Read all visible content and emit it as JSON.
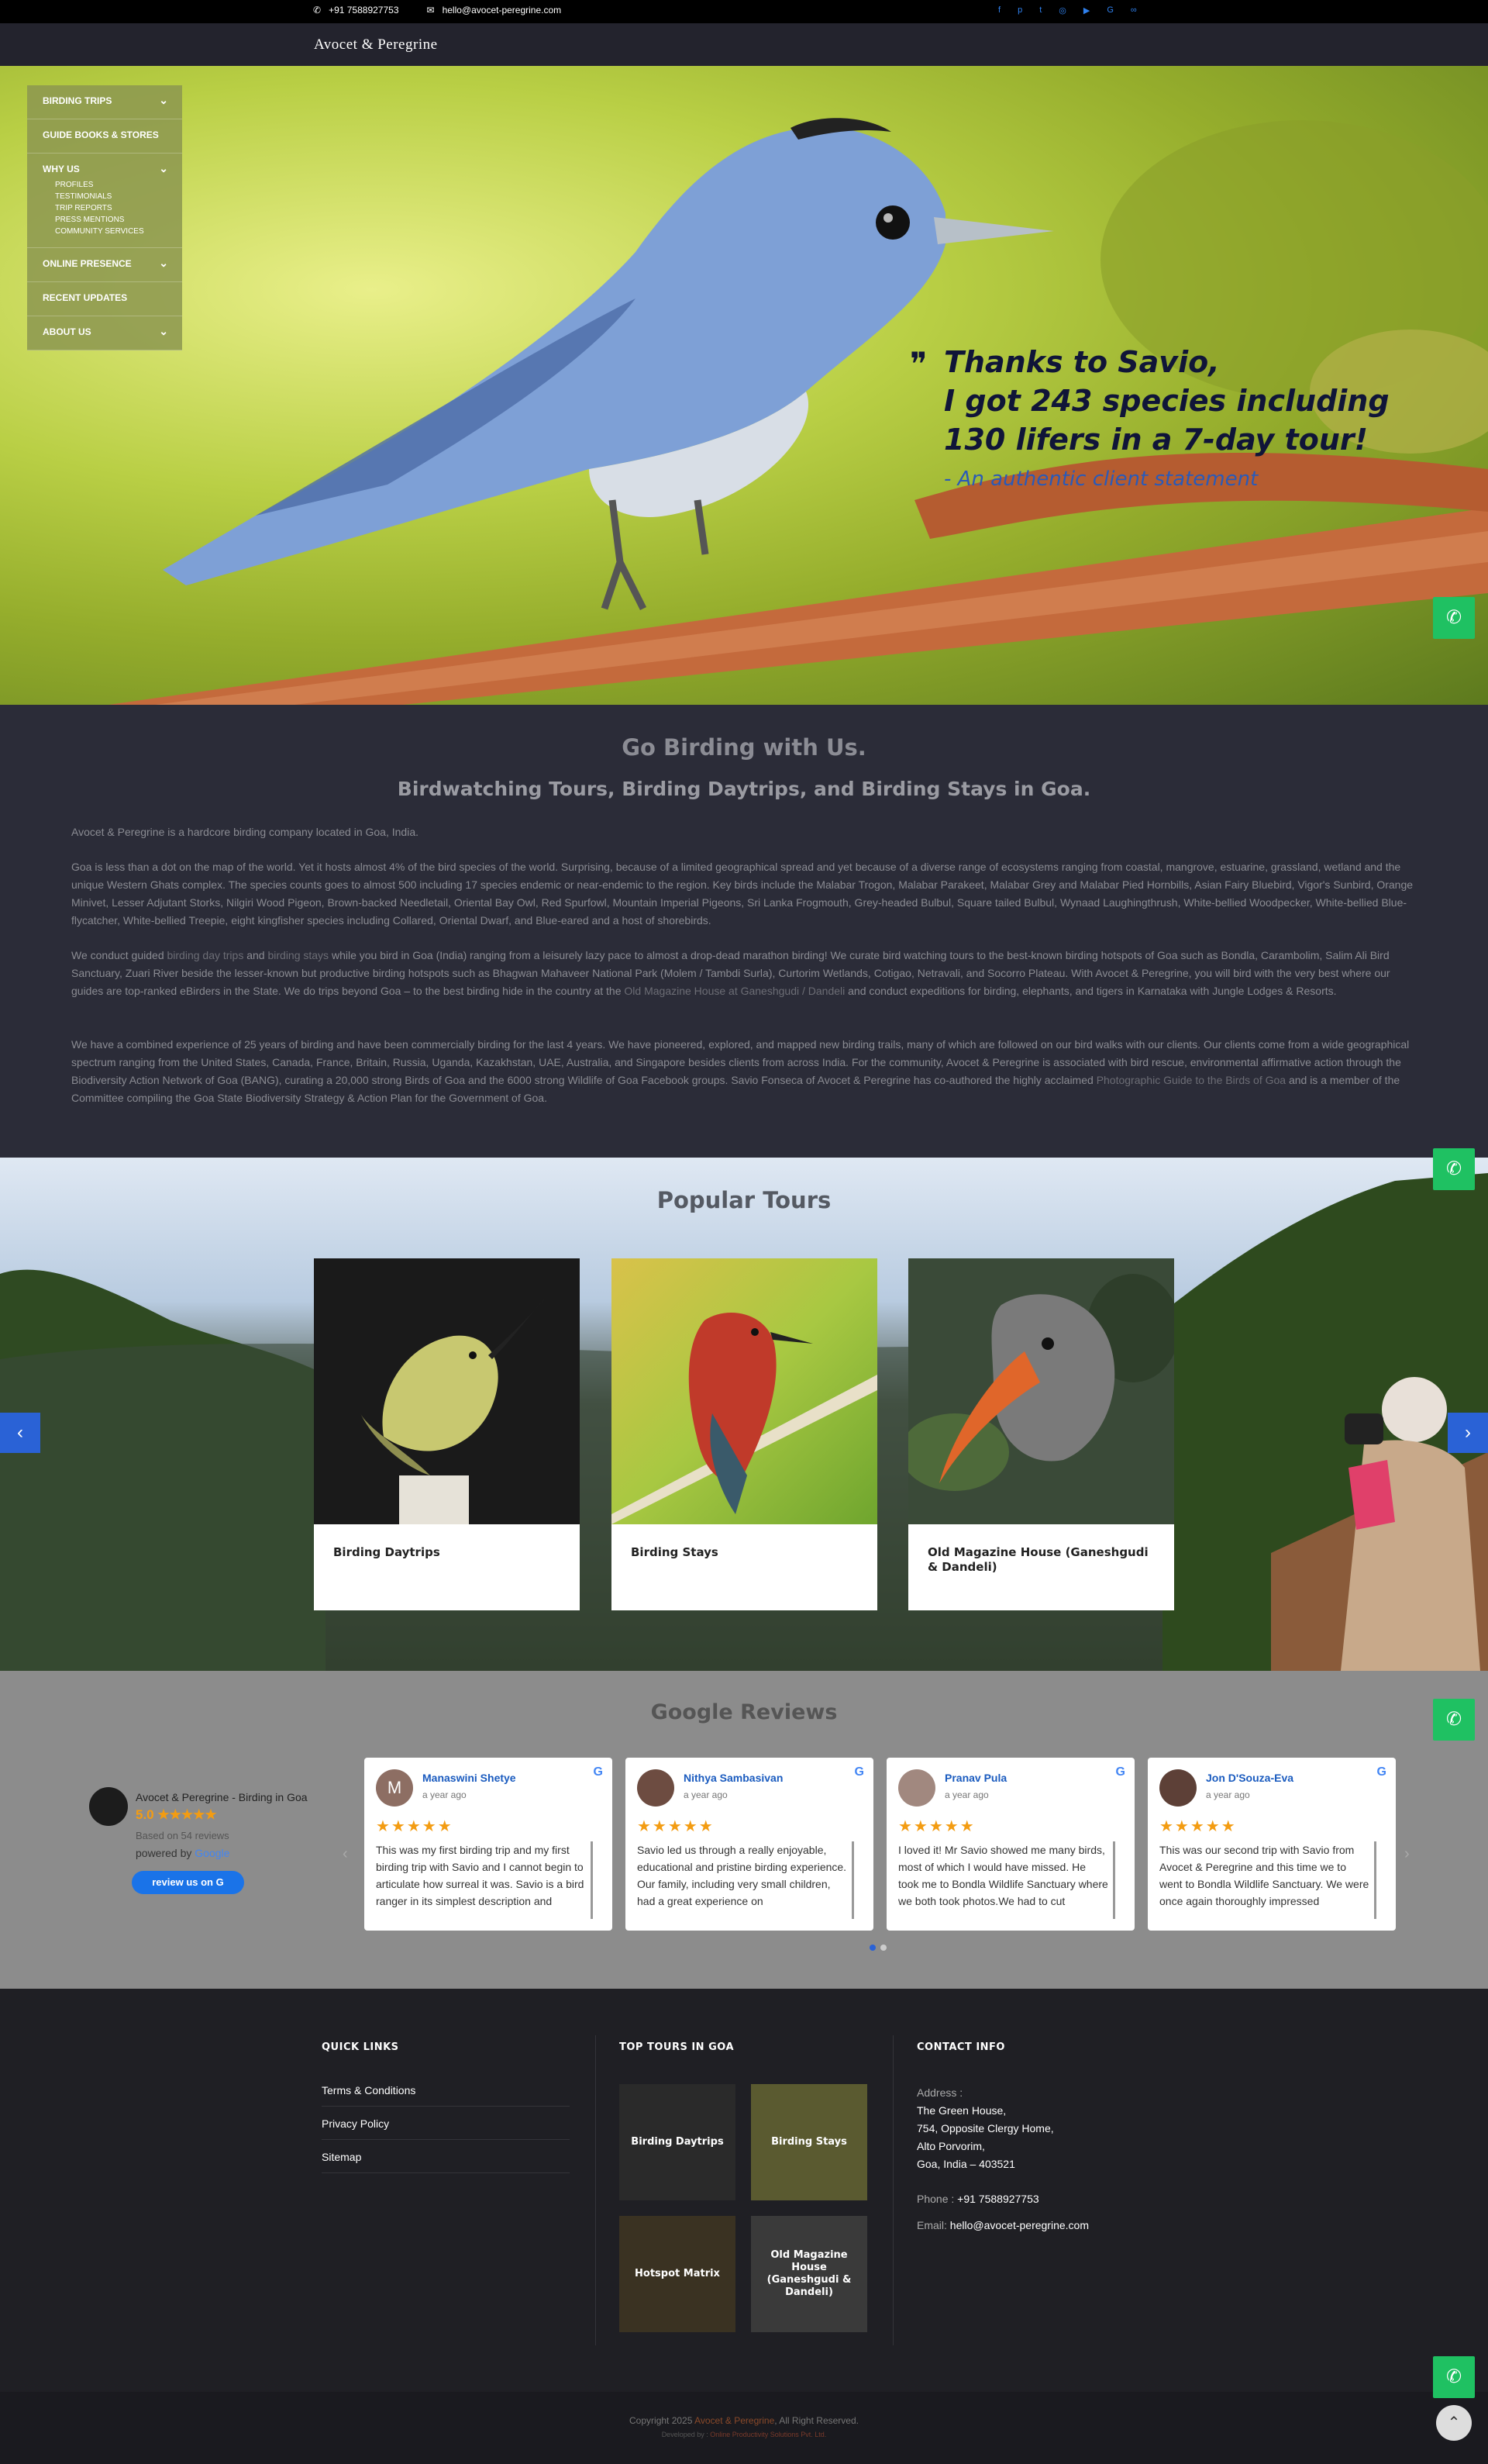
{
  "topbar": {
    "phone": "+91 7588927753",
    "email": "hello@avocet-peregrine.com",
    "social_icons": [
      "facebook-icon",
      "pinterest-icon",
      "twitter-icon",
      "instagram-icon",
      "youtube-icon",
      "google-icon",
      "tripadvisor-icon"
    ]
  },
  "brand": {
    "logo_text": "Avocet & Peregrine"
  },
  "menu": {
    "items": [
      {
        "label": "BIRDING TRIPS"
      },
      {
        "label": "GUIDE BOOKS & STORES"
      },
      {
        "label": "WHY US",
        "children": [
          "PROFILES",
          "TESTIMONIALS",
          "TRIP REPORTS",
          "PRESS MENTIONS",
          "COMMUNITY SERVICES"
        ]
      },
      {
        "label": "ONLINE PRESENCE"
      },
      {
        "label": "RECENT UPDATES"
      },
      {
        "label": "ABOUT US"
      }
    ]
  },
  "hero": {
    "quote_line1": "Thanks to Savio,",
    "quote_line2": "I got 243 species including",
    "quote_line3": "130 lifers in a 7-day tour!",
    "quote_sub": "- An authentic client statement",
    "slide_count": 25,
    "active_slide": 1
  },
  "about": {
    "title": "Go Birding with Us.",
    "subtitle": "Birdwatching Tours, Birding Daytrips, and Birding Stays in Goa.",
    "p1": "Avocet & Peregrine is a hardcore birding company located in Goa, India.",
    "p2": "Goa is less than a dot on the map of the world. Yet it hosts almost 4% of the bird species of the world. Surprising, because of a limited geographical spread and yet because of a diverse range of ecosystems ranging from coastal, mangrove, estuarine, grassland, wetland and the unique Western Ghats complex. The species counts goes to almost 500 including 17 species endemic or near-endemic to the region. Key birds include the Malabar Trogon, Malabar Parakeet, Malabar Grey and Malabar Pied Hornbills, Asian Fairy Bluebird, Vigor's Sunbird, Orange Minivet, Lesser Adjutant Storks, Nilgiri Wood Pigeon, Brown-backed Needletail, Oriental Bay Owl, Red Spurfowl, Mountain Imperial Pigeons, Sri Lanka Frogmouth, Grey-headed Bulbul, Square tailed Bulbul, Wynaad Laughingthrush, White-bellied Woodpecker, White-bellied Blue-flycatcher, White-bellied Treepie, eight kingfisher species including Collared, Oriental Dwarf, and Blue-eared and a host of shorebirds.",
    "p3_a": "We conduct guided ",
    "p3_link1": "birding day trips",
    "p3_b": " and ",
    "p3_link2": "birding stays",
    "p3_c": " while you bird in Goa (India) ranging from a leisurely lazy pace to almost a drop-dead marathon birding! We curate bird watching tours to the best-known birding hotspots of Goa such as Bondla, Carambolim, Salim Ali Bird Sanctuary, Zuari River beside the lesser-known but productive birding hotspots such as Bhagwan Mahaveer National Park (Molem / Tambdi Surla), Curtorim Wetlands, Cotigao, Netravali, and Socorro Plateau. With Avocet & Peregrine, you will bird with the very best where our guides are top-ranked eBirders in the State. We do trips beyond Goa – to the best birding hide in the country at the ",
    "p3_link3": "Old Magazine House at Ganeshgudi / Dandeli",
    "p3_d": " and conduct expeditions for birding, elephants, and tigers in Karnataka with Jungle Lodges & Resorts.",
    "p4_a": "We have a combined experience of 25 years of birding and have been commercially birding for the last 4 years. We have pioneered, explored, and mapped new birding trails, many of which are followed on our bird walks with our clients. Our clients come from a wide geographical spectrum ranging from the United States, Canada, France, Britain, Russia, Uganda, Kazakhstan, UAE, Australia, and Singapore besides clients from across India. For the community, Avocet & Peregrine is associated with bird rescue, environmental affirmative action through the Biodiversity Action Network of Goa (BANG), curating a 20,000 strong Birds of Goa and the 6000 strong Wildlife of Goa Facebook groups. Savio Fonseca of Avocet & Peregrine has co-authored the highly acclaimed ",
    "p4_link": "Photographic Guide to the Birds of Goa",
    "p4_b": " and is a member of the Committee compiling the Goa State Biodiversity Strategy & Action Plan for the Government of Goa."
  },
  "tours": {
    "title": "Popular Tours",
    "cards": [
      {
        "title": "Birding Daytrips"
      },
      {
        "title": "Birding Stays"
      },
      {
        "title": "Old Magazine House (Ganeshgudi & Dandeli)"
      }
    ]
  },
  "reviews": {
    "title": "Google Reviews",
    "business": "Avocet & Peregrine - Birding in Goa",
    "rating": "5.0",
    "stars": "★★★★★",
    "based_on": "Based on 54 reviews",
    "powered_by": "powered by",
    "google_word": "Google",
    "review_btn": "review us on",
    "items": [
      {
        "name": "Manaswini Shetye",
        "when": "a year ago",
        "initial": "M",
        "text": "This was my first birding trip and my first birding trip with Savio and I cannot begin to articulate how surreal it was. Savio is a bird ranger in its simplest description and"
      },
      {
        "name": "Nithya Sambasivan",
        "when": "a year ago",
        "initial": "",
        "text": "Savio led us through a really enjoyable, educational and pristine birding experience. Our family, including very small children, had a great experience on"
      },
      {
        "name": "Pranav Pula",
        "when": "a year ago",
        "initial": "",
        "text": "I loved it! Mr Savio showed me many birds, most of which I would have missed. He took me to Bondla Wildlife Sanctuary where we both took photos.We had to cut"
      },
      {
        "name": "Jon D'Souza-Eva",
        "when": "a year ago",
        "initial": "",
        "text": "This was our second trip with Savio from Avocet & Peregrine and this time we to went to Bondla Wildlife Sanctuary. We were once again thoroughly impressed"
      }
    ]
  },
  "footer": {
    "quick_links_title": "QUICK LINKS",
    "quick_links": [
      "Terms & Conditions",
      "Privacy Policy",
      "Sitemap"
    ],
    "top_tours_title": "TOP TOURS IN GOA",
    "top_tours": [
      "Birding Daytrips",
      "Birding Stays",
      "Hotspot Matrix",
      "Old Magazine House (Ganeshgudi & Dandeli)"
    ],
    "contact_title": "CONTACT INFO",
    "address_label": "Address :",
    "address_lines": [
      "The Green House,",
      "754, Opposite Clergy Home,",
      "Alto Porvorim,",
      "Goa, India – 403521"
    ],
    "phone_label": "Phone : ",
    "phone": "+91 7588927753",
    "email_label": "Email: ",
    "email": "hello@avocet-peregrine.com",
    "copyright_a": "Copyright 2025 ",
    "copyright_brand": "Avocet & Peregrine",
    "copyright_b": ", All Right Reserved.",
    "developed_a": "Developed by : ",
    "developed_b": "Online Productivity Solutions Pvt. Ltd."
  },
  "colors": {
    "accent": "#2a62d6",
    "whatsapp": "#1fc162",
    "star": "#f39c12"
  }
}
